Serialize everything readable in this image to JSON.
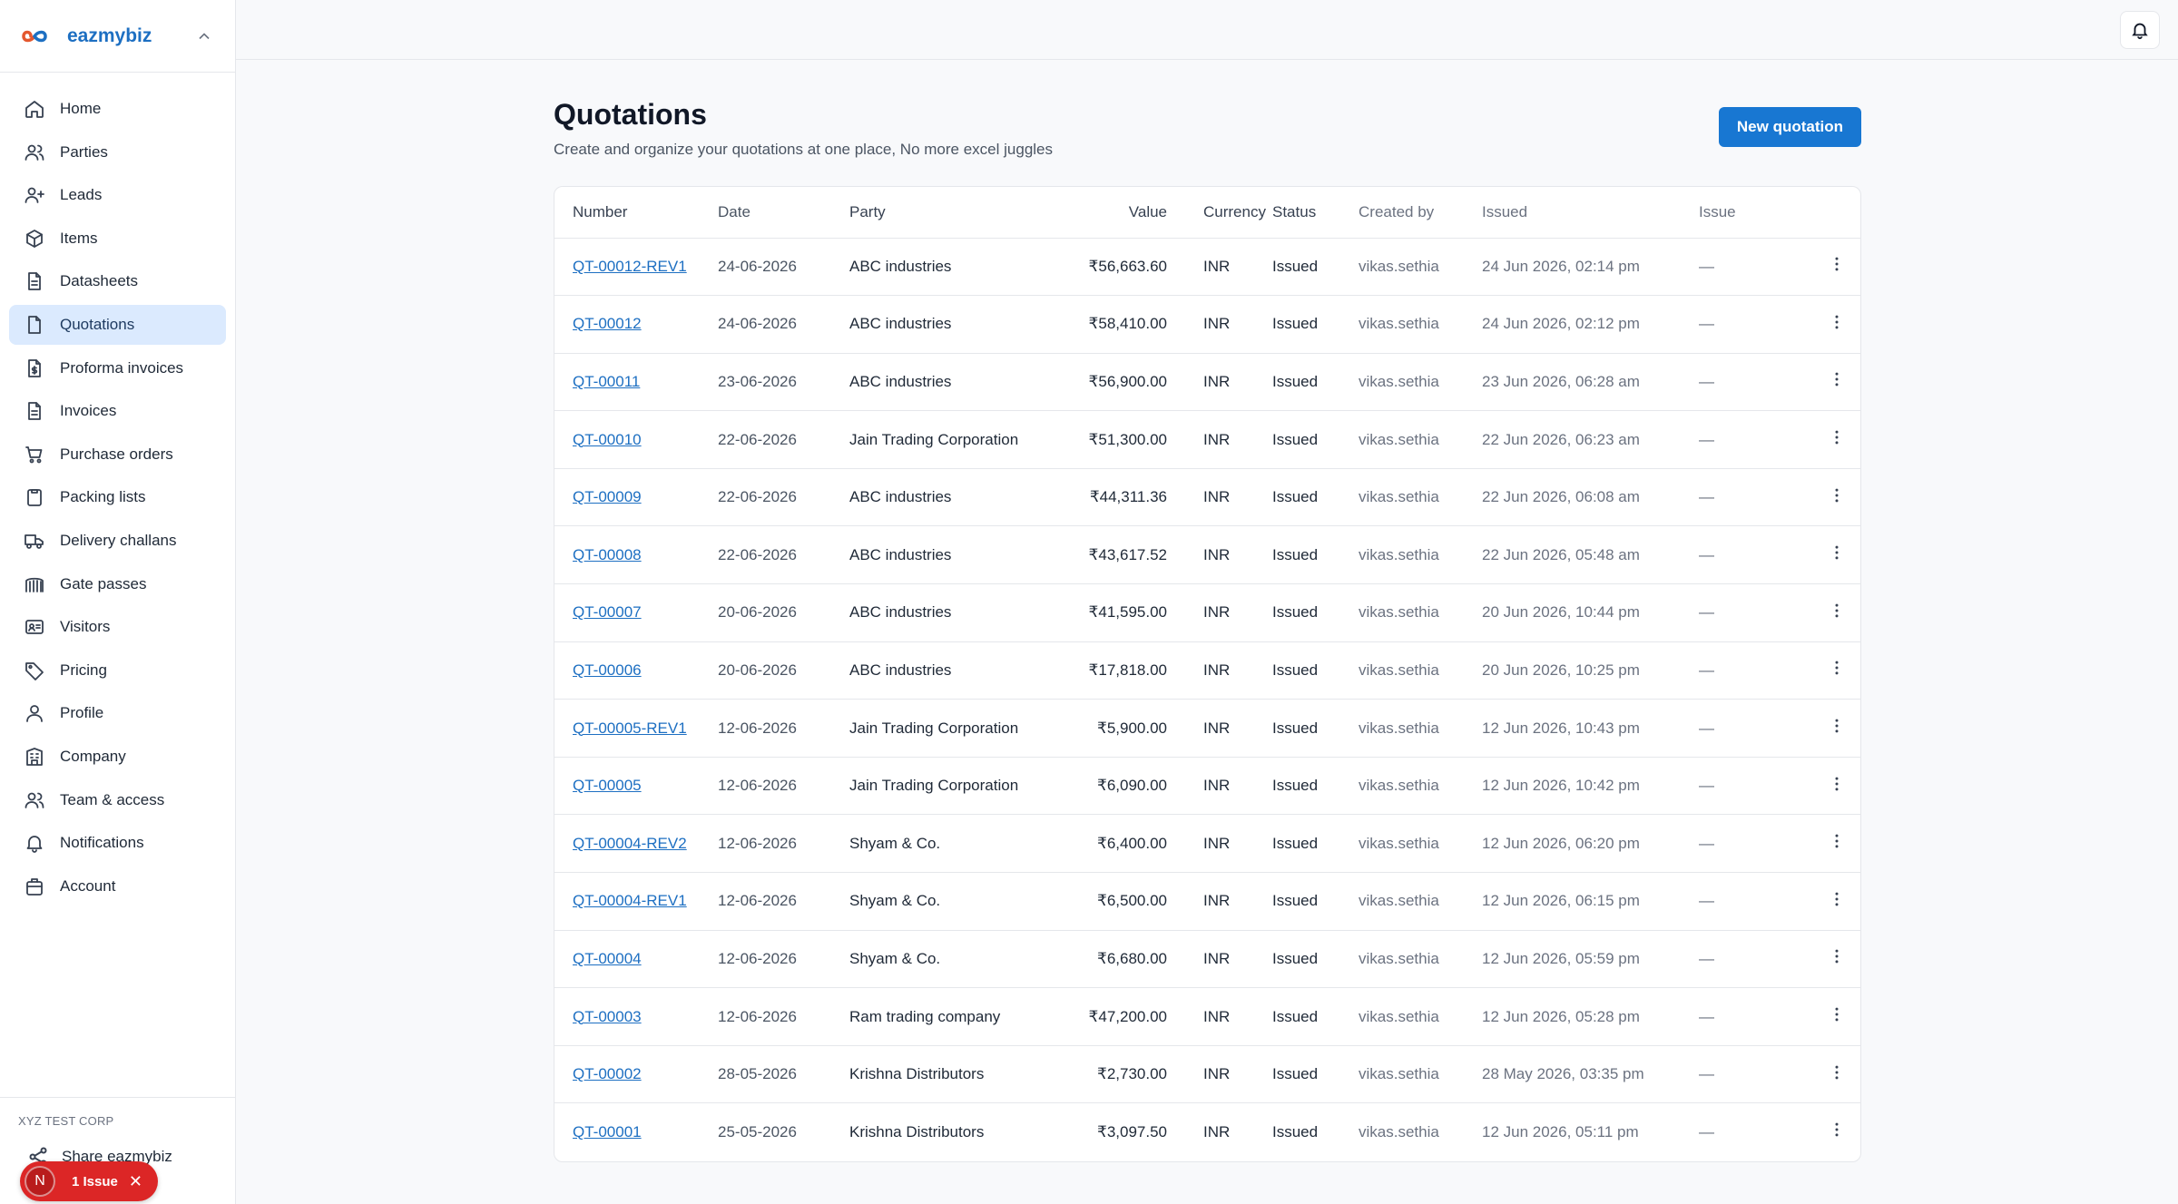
{
  "brand": {
    "name": "eazmybiz"
  },
  "nav": [
    {
      "label": "Home",
      "icon": "home-icon",
      "active": false
    },
    {
      "label": "Parties",
      "icon": "users-icon",
      "active": false
    },
    {
      "label": "Leads",
      "icon": "user-plus-icon",
      "active": false
    },
    {
      "label": "Items",
      "icon": "box-icon",
      "active": false
    },
    {
      "label": "Datasheets",
      "icon": "document-icon",
      "active": false
    },
    {
      "label": "Quotations",
      "icon": "file-icon",
      "active": true
    },
    {
      "label": "Proforma invoices",
      "icon": "file-dollar-icon",
      "active": false
    },
    {
      "label": "Invoices",
      "icon": "document-icon",
      "active": false
    },
    {
      "label": "Purchase orders",
      "icon": "cart-icon",
      "active": false
    },
    {
      "label": "Packing lists",
      "icon": "clipboard-icon",
      "active": false
    },
    {
      "label": "Delivery challans",
      "icon": "truck-icon",
      "active": false
    },
    {
      "label": "Gate passes",
      "icon": "gate-icon",
      "active": false
    },
    {
      "label": "Visitors",
      "icon": "id-card-icon",
      "active": false
    },
    {
      "label": "Pricing",
      "icon": "tag-icon",
      "active": false
    },
    {
      "label": "Profile",
      "icon": "user-icon",
      "active": false
    },
    {
      "label": "Company",
      "icon": "building-icon",
      "active": false
    },
    {
      "label": "Team & access",
      "icon": "users-icon",
      "active": false
    },
    {
      "label": "Notifications",
      "icon": "bell-icon",
      "active": false
    },
    {
      "label": "Account",
      "icon": "briefcase-icon",
      "active": false
    }
  ],
  "footer": {
    "org": "XYZ TEST CORP",
    "share_label": "Share eazmybiz",
    "issue_avatar": "N",
    "issue_label": "1 Issue"
  },
  "page": {
    "title": "Quotations",
    "subtitle": "Create and organize your quotations at one place, No more excel juggles",
    "new_button": "New quotation"
  },
  "table": {
    "columns": [
      "Number",
      "Date",
      "Party",
      "Value",
      "Currency",
      "Status",
      "Created by",
      "Issued",
      "Issue"
    ],
    "rows": [
      {
        "number": "QT-00012-REV1",
        "date": "24-06-2026",
        "party": "ABC industries",
        "value": "₹56,663.60",
        "currency": "INR",
        "status": "Issued",
        "created_by": "vikas.sethia",
        "issued": "24 Jun 2026, 02:14 pm",
        "issue": "—"
      },
      {
        "number": "QT-00012",
        "date": "24-06-2026",
        "party": "ABC industries",
        "value": "₹58,410.00",
        "currency": "INR",
        "status": "Issued",
        "created_by": "vikas.sethia",
        "issued": "24 Jun 2026, 02:12 pm",
        "issue": "—"
      },
      {
        "number": "QT-00011",
        "date": "23-06-2026",
        "party": "ABC industries",
        "value": "₹56,900.00",
        "currency": "INR",
        "status": "Issued",
        "created_by": "vikas.sethia",
        "issued": "23 Jun 2026, 06:28 am",
        "issue": "—"
      },
      {
        "number": "QT-00010",
        "date": "22-06-2026",
        "party": "Jain Trading Corporation",
        "value": "₹51,300.00",
        "currency": "INR",
        "status": "Issued",
        "created_by": "vikas.sethia",
        "issued": "22 Jun 2026, 06:23 am",
        "issue": "—"
      },
      {
        "number": "QT-00009",
        "date": "22-06-2026",
        "party": "ABC industries",
        "value": "₹44,311.36",
        "currency": "INR",
        "status": "Issued",
        "created_by": "vikas.sethia",
        "issued": "22 Jun 2026, 06:08 am",
        "issue": "—"
      },
      {
        "number": "QT-00008",
        "date": "22-06-2026",
        "party": "ABC industries",
        "value": "₹43,617.52",
        "currency": "INR",
        "status": "Issued",
        "created_by": "vikas.sethia",
        "issued": "22 Jun 2026, 05:48 am",
        "issue": "—"
      },
      {
        "number": "QT-00007",
        "date": "20-06-2026",
        "party": "ABC industries",
        "value": "₹41,595.00",
        "currency": "INR",
        "status": "Issued",
        "created_by": "vikas.sethia",
        "issued": "20 Jun 2026, 10:44 pm",
        "issue": "—"
      },
      {
        "number": "QT-00006",
        "date": "20-06-2026",
        "party": "ABC industries",
        "value": "₹17,818.00",
        "currency": "INR",
        "status": "Issued",
        "created_by": "vikas.sethia",
        "issued": "20 Jun 2026, 10:25 pm",
        "issue": "—"
      },
      {
        "number": "QT-00005-REV1",
        "date": "12-06-2026",
        "party": "Jain Trading Corporation",
        "value": "₹5,900.00",
        "currency": "INR",
        "status": "Issued",
        "created_by": "vikas.sethia",
        "issued": "12 Jun 2026, 10:43 pm",
        "issue": "—"
      },
      {
        "number": "QT-00005",
        "date": "12-06-2026",
        "party": "Jain Trading Corporation",
        "value": "₹6,090.00",
        "currency": "INR",
        "status": "Issued",
        "created_by": "vikas.sethia",
        "issued": "12 Jun 2026, 10:42 pm",
        "issue": "—"
      },
      {
        "number": "QT-00004-REV2",
        "date": "12-06-2026",
        "party": "Shyam & Co.",
        "value": "₹6,400.00",
        "currency": "INR",
        "status": "Issued",
        "created_by": "vikas.sethia",
        "issued": "12 Jun 2026, 06:20 pm",
        "issue": "—"
      },
      {
        "number": "QT-00004-REV1",
        "date": "12-06-2026",
        "party": "Shyam & Co.",
        "value": "₹6,500.00",
        "currency": "INR",
        "status": "Issued",
        "created_by": "vikas.sethia",
        "issued": "12 Jun 2026, 06:15 pm",
        "issue": "—"
      },
      {
        "number": "QT-00004",
        "date": "12-06-2026",
        "party": "Shyam & Co.",
        "value": "₹6,680.00",
        "currency": "INR",
        "status": "Issued",
        "created_by": "vikas.sethia",
        "issued": "12 Jun 2026, 05:59 pm",
        "issue": "—"
      },
      {
        "number": "QT-00003",
        "date": "12-06-2026",
        "party": "Ram trading company",
        "value": "₹47,200.00",
        "currency": "INR",
        "status": "Issued",
        "created_by": "vikas.sethia",
        "issued": "12 Jun 2026, 05:28 pm",
        "issue": "—"
      },
      {
        "number": "QT-00002",
        "date": "28-05-2026",
        "party": "Krishna Distributors",
        "value": "₹2,730.00",
        "currency": "INR",
        "status": "Issued",
        "created_by": "vikas.sethia",
        "issued": "28 May 2026, 03:35 pm",
        "issue": "—"
      },
      {
        "number": "QT-00001",
        "date": "25-05-2026",
        "party": "Krishna Distributors",
        "value": "₹3,097.50",
        "currency": "INR",
        "status": "Issued",
        "created_by": "vikas.sethia",
        "issued": "12 Jun 2026, 05:11 pm",
        "issue": "—"
      }
    ]
  },
  "colors": {
    "accent": "#1877d2",
    "active_nav": "#dbeafe",
    "issue_pill": "#dc2626"
  }
}
